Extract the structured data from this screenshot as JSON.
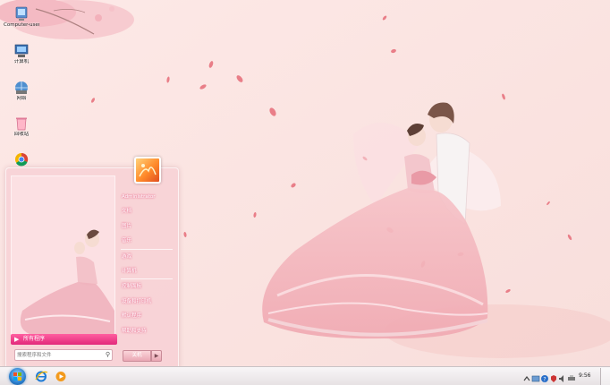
{
  "desktop": {
    "icons": [
      {
        "name": "desktop-icon-computer",
        "icon": "monitor-icon",
        "label": "Computer-user"
      },
      {
        "name": "desktop-icon-computer2",
        "icon": "pc-icon",
        "label": "计算机"
      },
      {
        "name": "desktop-icon-network",
        "icon": "network-icon",
        "label": "网络"
      },
      {
        "name": "desktop-icon-recycle-bin",
        "icon": "recycle-bin-icon",
        "label": "回收站"
      },
      {
        "name": "desktop-icon-browser",
        "icon": "browser-icon",
        "label": ""
      }
    ]
  },
  "start_menu": {
    "all_programs": "所有程序",
    "search_placeholder": "搜索程序和文件",
    "right_items": [
      {
        "label": "Administrator"
      },
      {
        "label": "文档"
      },
      {
        "label": "图片"
      },
      {
        "label": "音乐"
      },
      {
        "label": "游戏"
      },
      {
        "label": "计算机"
      },
      {
        "label": "控制面板"
      },
      {
        "label": "设备和打印机"
      },
      {
        "label": "默认程序"
      },
      {
        "label": "帮助和支持"
      }
    ],
    "shutdown_label": "关机",
    "shutdown_arrow": "▶"
  },
  "taskbar": {
    "clock": "9:56",
    "buttons": [
      {
        "name": "taskbar-ie-button",
        "icon": "ie-icon"
      },
      {
        "name": "taskbar-media-button",
        "icon": "media-player-icon"
      }
    ],
    "tray": [
      {
        "name": "tray-expand-icon"
      },
      {
        "name": "tray-network-icon"
      },
      {
        "name": "tray-help-icon"
      },
      {
        "name": "tray-security-icon"
      },
      {
        "name": "tray-volume-icon"
      },
      {
        "name": "tray-printer-icon"
      }
    ]
  },
  "colors": {
    "wallpaper": "#fbe6e4",
    "accent_pink": "#e2287a",
    "menu_tint": "#f7cdd2"
  }
}
